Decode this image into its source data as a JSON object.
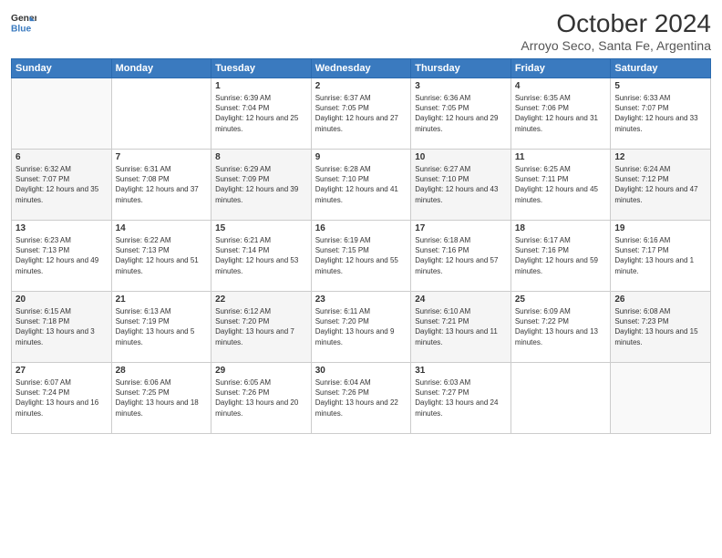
{
  "logo": {
    "general": "General",
    "blue": "Blue"
  },
  "title": "October 2024",
  "location": "Arroyo Seco, Santa Fe, Argentina",
  "days_header": [
    "Sunday",
    "Monday",
    "Tuesday",
    "Wednesday",
    "Thursday",
    "Friday",
    "Saturday"
  ],
  "weeks": [
    [
      {
        "day": "",
        "info": ""
      },
      {
        "day": "",
        "info": ""
      },
      {
        "day": "1",
        "info": "Sunrise: 6:39 AM\nSunset: 7:04 PM\nDaylight: 12 hours and 25 minutes."
      },
      {
        "day": "2",
        "info": "Sunrise: 6:37 AM\nSunset: 7:05 PM\nDaylight: 12 hours and 27 minutes."
      },
      {
        "day": "3",
        "info": "Sunrise: 6:36 AM\nSunset: 7:05 PM\nDaylight: 12 hours and 29 minutes."
      },
      {
        "day": "4",
        "info": "Sunrise: 6:35 AM\nSunset: 7:06 PM\nDaylight: 12 hours and 31 minutes."
      },
      {
        "day": "5",
        "info": "Sunrise: 6:33 AM\nSunset: 7:07 PM\nDaylight: 12 hours and 33 minutes."
      }
    ],
    [
      {
        "day": "6",
        "info": "Sunrise: 6:32 AM\nSunset: 7:07 PM\nDaylight: 12 hours and 35 minutes."
      },
      {
        "day": "7",
        "info": "Sunrise: 6:31 AM\nSunset: 7:08 PM\nDaylight: 12 hours and 37 minutes."
      },
      {
        "day": "8",
        "info": "Sunrise: 6:29 AM\nSunset: 7:09 PM\nDaylight: 12 hours and 39 minutes."
      },
      {
        "day": "9",
        "info": "Sunrise: 6:28 AM\nSunset: 7:10 PM\nDaylight: 12 hours and 41 minutes."
      },
      {
        "day": "10",
        "info": "Sunrise: 6:27 AM\nSunset: 7:10 PM\nDaylight: 12 hours and 43 minutes."
      },
      {
        "day": "11",
        "info": "Sunrise: 6:25 AM\nSunset: 7:11 PM\nDaylight: 12 hours and 45 minutes."
      },
      {
        "day": "12",
        "info": "Sunrise: 6:24 AM\nSunset: 7:12 PM\nDaylight: 12 hours and 47 minutes."
      }
    ],
    [
      {
        "day": "13",
        "info": "Sunrise: 6:23 AM\nSunset: 7:13 PM\nDaylight: 12 hours and 49 minutes."
      },
      {
        "day": "14",
        "info": "Sunrise: 6:22 AM\nSunset: 7:13 PM\nDaylight: 12 hours and 51 minutes."
      },
      {
        "day": "15",
        "info": "Sunrise: 6:21 AM\nSunset: 7:14 PM\nDaylight: 12 hours and 53 minutes."
      },
      {
        "day": "16",
        "info": "Sunrise: 6:19 AM\nSunset: 7:15 PM\nDaylight: 12 hours and 55 minutes."
      },
      {
        "day": "17",
        "info": "Sunrise: 6:18 AM\nSunset: 7:16 PM\nDaylight: 12 hours and 57 minutes."
      },
      {
        "day": "18",
        "info": "Sunrise: 6:17 AM\nSunset: 7:16 PM\nDaylight: 12 hours and 59 minutes."
      },
      {
        "day": "19",
        "info": "Sunrise: 6:16 AM\nSunset: 7:17 PM\nDaylight: 13 hours and 1 minute."
      }
    ],
    [
      {
        "day": "20",
        "info": "Sunrise: 6:15 AM\nSunset: 7:18 PM\nDaylight: 13 hours and 3 minutes."
      },
      {
        "day": "21",
        "info": "Sunrise: 6:13 AM\nSunset: 7:19 PM\nDaylight: 13 hours and 5 minutes."
      },
      {
        "day": "22",
        "info": "Sunrise: 6:12 AM\nSunset: 7:20 PM\nDaylight: 13 hours and 7 minutes."
      },
      {
        "day": "23",
        "info": "Sunrise: 6:11 AM\nSunset: 7:20 PM\nDaylight: 13 hours and 9 minutes."
      },
      {
        "day": "24",
        "info": "Sunrise: 6:10 AM\nSunset: 7:21 PM\nDaylight: 13 hours and 11 minutes."
      },
      {
        "day": "25",
        "info": "Sunrise: 6:09 AM\nSunset: 7:22 PM\nDaylight: 13 hours and 13 minutes."
      },
      {
        "day": "26",
        "info": "Sunrise: 6:08 AM\nSunset: 7:23 PM\nDaylight: 13 hours and 15 minutes."
      }
    ],
    [
      {
        "day": "27",
        "info": "Sunrise: 6:07 AM\nSunset: 7:24 PM\nDaylight: 13 hours and 16 minutes."
      },
      {
        "day": "28",
        "info": "Sunrise: 6:06 AM\nSunset: 7:25 PM\nDaylight: 13 hours and 18 minutes."
      },
      {
        "day": "29",
        "info": "Sunrise: 6:05 AM\nSunset: 7:26 PM\nDaylight: 13 hours and 20 minutes."
      },
      {
        "day": "30",
        "info": "Sunrise: 6:04 AM\nSunset: 7:26 PM\nDaylight: 13 hours and 22 minutes."
      },
      {
        "day": "31",
        "info": "Sunrise: 6:03 AM\nSunset: 7:27 PM\nDaylight: 13 hours and 24 minutes."
      },
      {
        "day": "",
        "info": ""
      },
      {
        "day": "",
        "info": ""
      }
    ]
  ]
}
